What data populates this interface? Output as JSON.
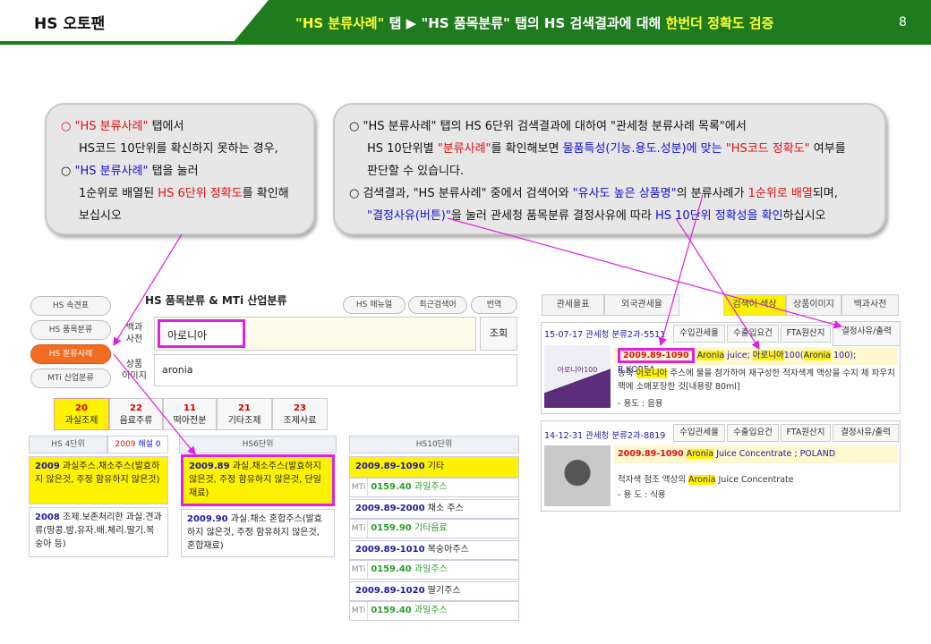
{
  "header": {
    "brand": "HS 오토팬",
    "title_q1": "\"HS 분류사례\"",
    "title_t1": " 탭  ▶ ",
    "title_q2": "\"HS 품목분류\"",
    "title_t2": " 탭의 HS 검색결과에 대해 ",
    "title_hl": "한번더 정확도 검증",
    "page": "8",
    "colors": {
      "green": "#1e7b1e",
      "highlight": "#ffff33"
    }
  },
  "callout1": {
    "l1_bullet": "○ ",
    "l1_red": "\"HS 분류사례\"",
    "l1_text": " 탭에서",
    "l2": "HS코드 10단위를 확신하지 못하는 경우,",
    "l3_bullet": "○ ",
    "l3_blue": "\"HS 분류사례\"",
    "l3_text": " 탭을 눌러",
    "l4_a": "1순위로 배열된 ",
    "l4_red": "HS 6단위 정확도",
    "l4_b": "를 확인해",
    "l5": "보십시오"
  },
  "callout2": {
    "l1": "○ \"HS 분류사례\" 탭의 HS 6단위 검색결과에 대하여 \"관세청 분류사례 목록\"에서",
    "l2_a": "HS 10단위별 ",
    "l2_red": "\"분류사례\"",
    "l2_b": "를 확인해보면 ",
    "l2_blue": "물품특성(기능.용도.성분)에 맞는",
    "l2_red2": " \"HS코드 정확도\"",
    "l2_c": " 여부를",
    "l3": "판단할 수 있습니다.",
    "l4_a": "○ 검색결과, \"HS 분류사례\" 중에서 검색어와 ",
    "l4_blue": "\"유사도 높은 상품명\"",
    "l4_b": "의 분류사례가 ",
    "l4_red": "1순위로 배열",
    "l4_c": "되며,",
    "l5_blue": "\"결정사유(버튼)\"",
    "l5_a": "을 눌러 관세청 품목분류 결정사유에 따라 ",
    "l5_blue2": "HS 10단위 정확성을 확인",
    "l5_b": "하십시오"
  },
  "left_app": {
    "title": "HS 품목분류  &  MTi 산업분류",
    "side": [
      "HS 속견표",
      "HS 품목분류",
      "HS 분류사례",
      "MTi 산업분류"
    ],
    "top_btns": [
      "HS 매뉴얼",
      "최근검색어",
      "번역"
    ],
    "label_dict": "백과\n사전",
    "label_img": "상품\n이미지",
    "search_value": "아로니아",
    "search_btn": "조회",
    "english_value": "aronia",
    "categories": [
      {
        "n": "20",
        "label": "과실조제"
      },
      {
        "n": "22",
        "label": "음료주류"
      },
      {
        "n": "11",
        "label": "떡아전분"
      },
      {
        "n": "21",
        "label": "기타조제"
      },
      {
        "n": "23",
        "label": "조제사료"
      }
    ],
    "col4_title": "HS 4단위",
    "col4_code": "2009",
    "col4_suffix": " 해설 0",
    "col6_title": "HS6단위",
    "col10_title": "HS10단위",
    "hs4": [
      {
        "code": "2009",
        "text": "과실주스.채소주스(발효하지 않은것, 주정 함유하지 않은것)"
      },
      {
        "code": "2008",
        "text": "조제.보존처리한 과실.견과류(땅콩.밤.유자.배.체리.딸기.복숭아 등)"
      }
    ],
    "hs6": [
      {
        "code": "2009.89",
        "text": "과실.채소주스(발효하지 않은것, 주정 함유하지 않은것, 단일재료)"
      },
      {
        "code": "2009.90",
        "text": "과실.채소 혼합주스(발효하지 않은것, 주정 함유하지 않은것, 혼합재료)"
      }
    ],
    "hs10": [
      {
        "code_a": "2009.",
        "code_b": "89",
        "code_c": "-1090",
        "name": "기타",
        "mti": "0159.40",
        "mti_name": "과일주스"
      },
      {
        "code_a": "2009.",
        "code_b": "89",
        "code_c": "-2000",
        "name": "채소 주스",
        "mti": "0159.90",
        "mti_name": "기타음료"
      },
      {
        "code_a": "2009.",
        "code_b": "89",
        "code_c": "-1010",
        "name": "복숭아주스",
        "mti": "0159.40",
        "mti_name": "과일주스"
      },
      {
        "code_a": "2009.",
        "code_b": "89",
        "code_c": "-1020",
        "name": "딸기주스",
        "mti": "0159.40",
        "mti_name": "과일주스"
      }
    ],
    "mti_tag": "MTi"
  },
  "right_app": {
    "tabs": [
      "관세율표",
      "외국관세율",
      "검색어 색상",
      "상품이미지",
      "백과사전"
    ],
    "card1": {
      "date": "15-07-17",
      "ref": "관세청 분류2과-5511",
      "btns": [
        "수입관세율",
        "수출입요건",
        "FTA원산지",
        "결정사유/출력"
      ],
      "code": "2009.89-1090",
      "p1": "Aronia",
      "p2": " juice; ",
      "p3": "아로니아",
      "p4": "100(",
      "p5": "Aronia",
      "p6": " 100); R.KOREA",
      "d1": "농축 ",
      "d2": "아로니아",
      "d3": " 주스에 물을 첨가하여 재구성한 적자색계 액상을 수지 체 파우치 팩에 소매포장한 것[내용량 80ml]",
      "use": "- 용도 : 음용",
      "thumb_text": "아로니아100"
    },
    "card2": {
      "date": "14-12-31",
      "ref": "관세청 분류2과-8819",
      "btns": [
        "수입관세율",
        "수출입요건",
        "FTA원산지",
        "결정사유/출력"
      ],
      "code": "2009.89-1090",
      "p1": "Aronia",
      "p2": " Juice Concentrate ; POLAND",
      "d1": "적자색 점조 액상의 ",
      "d2": "Aronia",
      "d3": " Juice Concentrate",
      "use": "- 용 도 : 식용"
    }
  }
}
